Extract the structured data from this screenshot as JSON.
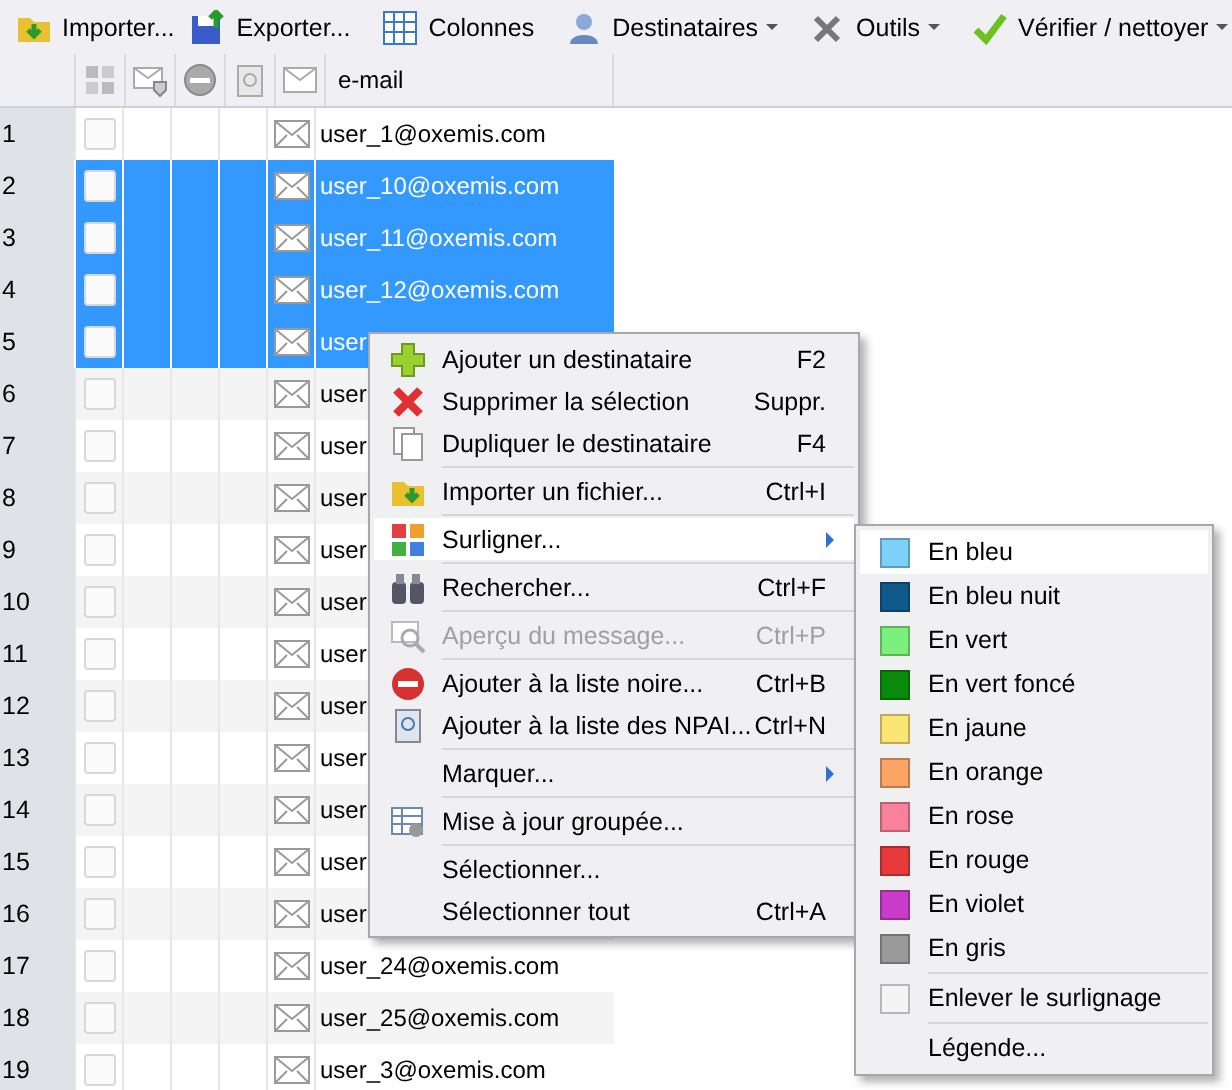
{
  "toolbar": {
    "buttons": [
      {
        "label": "Importer...",
        "dropdown": false
      },
      {
        "label": "Exporter...",
        "dropdown": false
      },
      {
        "label": "Colonnes",
        "dropdown": false
      },
      {
        "label": "Destinataires",
        "dropdown": true
      },
      {
        "label": "Outils",
        "dropdown": true
      },
      {
        "label": "Vérifier / nettoyer",
        "dropdown": true
      }
    ]
  },
  "table": {
    "columns": [
      {
        "kind": "icon"
      },
      {
        "kind": "icon"
      },
      {
        "kind": "icon"
      },
      {
        "kind": "icon"
      },
      {
        "kind": "icon"
      },
      {
        "kind": "text",
        "label": "e-mail"
      }
    ],
    "rows": [
      {
        "number": "1",
        "email": "user_1@oxemis.com",
        "selected": false
      },
      {
        "number": "2",
        "email": "user_10@oxemis.com",
        "selected": true
      },
      {
        "number": "3",
        "email": "user_11@oxemis.com",
        "selected": true
      },
      {
        "number": "4",
        "email": "user_12@oxemis.com",
        "selected": true
      },
      {
        "number": "5",
        "email": "user",
        "selected": true
      },
      {
        "number": "6",
        "email": "user",
        "selected": false
      },
      {
        "number": "7",
        "email": "user",
        "selected": false
      },
      {
        "number": "8",
        "email": "user",
        "selected": false
      },
      {
        "number": "9",
        "email": "user",
        "selected": false
      },
      {
        "number": "10",
        "email": "user",
        "selected": false
      },
      {
        "number": "11",
        "email": "user",
        "selected": false
      },
      {
        "number": "12",
        "email": "user",
        "selected": false
      },
      {
        "number": "13",
        "email": "user",
        "selected": false
      },
      {
        "number": "14",
        "email": "user",
        "selected": false
      },
      {
        "number": "15",
        "email": "user",
        "selected": false
      },
      {
        "number": "16",
        "email": "user",
        "selected": false
      },
      {
        "number": "17",
        "email": "user_24@oxemis.com",
        "selected": false
      },
      {
        "number": "18",
        "email": "user_25@oxemis.com",
        "selected": false
      },
      {
        "number": "19",
        "email": "user_3@oxemis.com",
        "selected": false
      }
    ]
  },
  "context_menu": {
    "items": [
      {
        "kind": "item",
        "label": "Ajouter un destinataire",
        "shortcut": "F2",
        "disabled": false,
        "selected": false,
        "submenu": false
      },
      {
        "kind": "item",
        "label": "Supprimer la sélection",
        "shortcut": "Suppr.",
        "disabled": false,
        "selected": false,
        "submenu": false
      },
      {
        "kind": "item",
        "label": "Dupliquer le destinataire",
        "shortcut": "F4",
        "disabled": false,
        "selected": false,
        "submenu": false
      },
      {
        "kind": "separator"
      },
      {
        "kind": "item",
        "label": "Importer un fichier...",
        "shortcut": "Ctrl+I",
        "disabled": false,
        "selected": false,
        "submenu": false
      },
      {
        "kind": "separator"
      },
      {
        "kind": "item",
        "label": "Surligner...",
        "disabled": false,
        "selected": true,
        "submenu": true
      },
      {
        "kind": "separator"
      },
      {
        "kind": "item",
        "label": "Rechercher...",
        "shortcut": "Ctrl+F",
        "disabled": false,
        "selected": false,
        "submenu": false
      },
      {
        "kind": "separator"
      },
      {
        "kind": "item",
        "label": "Aperçu du message...",
        "shortcut": "Ctrl+P",
        "disabled": true,
        "selected": false,
        "submenu": false
      },
      {
        "kind": "separator"
      },
      {
        "kind": "item",
        "label": "Ajouter à la liste noire...",
        "shortcut": "Ctrl+B",
        "disabled": false,
        "selected": false,
        "submenu": false
      },
      {
        "kind": "item",
        "label": "Ajouter à la liste des NPAI...",
        "shortcut": "Ctrl+N",
        "disabled": false,
        "selected": false,
        "submenu": false
      },
      {
        "kind": "separator"
      },
      {
        "kind": "item",
        "label": "Marquer...",
        "disabled": false,
        "selected": false,
        "submenu": true
      },
      {
        "kind": "separator"
      },
      {
        "kind": "item",
        "label": "Mise à jour groupée...",
        "disabled": false,
        "selected": false,
        "submenu": false
      },
      {
        "kind": "separator"
      },
      {
        "kind": "item",
        "label": "Sélectionner...",
        "disabled": false,
        "selected": false,
        "submenu": false
      },
      {
        "kind": "item",
        "label": "Sélectionner tout",
        "shortcut": "Ctrl+A",
        "disabled": false,
        "selected": false,
        "submenu": false
      }
    ]
  },
  "highlight_menu": {
    "items": [
      {
        "kind": "color",
        "label": "En bleu",
        "color": "#7dd0f7",
        "selected": true
      },
      {
        "kind": "color",
        "label": "En bleu nuit",
        "color": "#0f5a8a",
        "selected": false
      },
      {
        "kind": "color",
        "label": "En vert",
        "color": "#7cf07c",
        "selected": false
      },
      {
        "kind": "color",
        "label": "En vert foncé",
        "color": "#0a8a0a",
        "selected": false
      },
      {
        "kind": "color",
        "label": "En jaune",
        "color": "#fbe574",
        "selected": false
      },
      {
        "kind": "color",
        "label": "En orange",
        "color": "#fba466",
        "selected": false
      },
      {
        "kind": "color",
        "label": "En rose",
        "color": "#f7829a",
        "selected": false
      },
      {
        "kind": "color",
        "label": "En rouge",
        "color": "#e83a3a",
        "selected": false
      },
      {
        "kind": "color",
        "label": "En violet",
        "color": "#c93cc9",
        "selected": false
      },
      {
        "kind": "color",
        "label": "En gris",
        "color": "#9a9a9a",
        "selected": false
      },
      {
        "kind": "separator"
      },
      {
        "kind": "color",
        "label": "Enlever le surlignage",
        "color": "#f4f4f4",
        "selected": false
      },
      {
        "kind": "separator"
      },
      {
        "kind": "item",
        "label": "Légende...",
        "selected": false
      }
    ]
  }
}
